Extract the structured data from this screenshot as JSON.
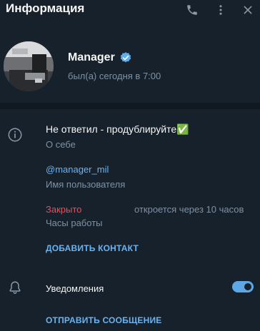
{
  "header": {
    "title": "Информация",
    "icons": [
      "phone-icon",
      "more-vertical-icon",
      "close-icon"
    ]
  },
  "profile": {
    "name": "Manager",
    "status": "был(а) сегодня в 7:00",
    "verified_icon": "verified-check-icon"
  },
  "about": {
    "text": "Не ответил - продублируйте✅",
    "label": "О себе"
  },
  "username": {
    "value": "@manager_mil",
    "label": "Имя пользователя"
  },
  "hours": {
    "state": "Закрыто",
    "opens": "откроется через 10 часов",
    "label": "Часы работы"
  },
  "actions": {
    "add_contact": "ДОБАВИТЬ КОНТАКТ",
    "send_message": "ОТПРАВИТЬ СООБЩЕНИЕ"
  },
  "notifications": {
    "label": "Уведомления",
    "enabled": true
  },
  "colors": {
    "background": "#17212b",
    "accent": "#6ab3f3",
    "secondary_text": "#7f91a4",
    "closed": "#e0515d"
  }
}
